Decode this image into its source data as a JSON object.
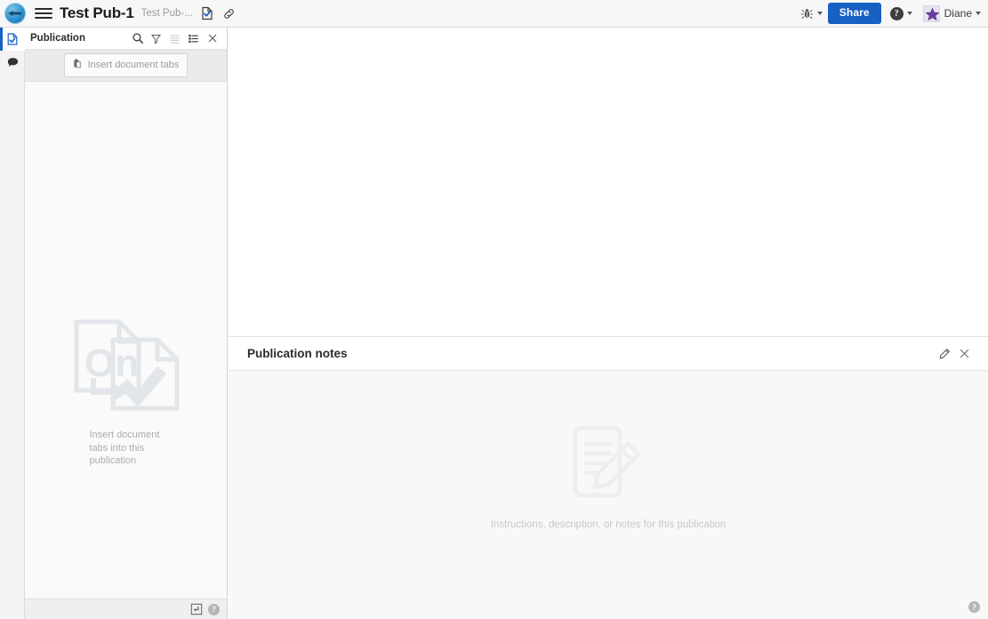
{
  "topbar": {
    "logo_icon": "app-logo-icon",
    "menu_icon": "hamburger-menu-icon",
    "title": "Test Pub-1",
    "subtitle": "Test Pub-...",
    "doc_check_icon": "document-check-icon",
    "link_icon": "link-icon",
    "bug_icon": "bug-icon",
    "share_label": "Share",
    "help_icon": "help-circle-icon",
    "avatar_icon": "user-avatar",
    "user_name": "Diane",
    "accent_color": "#1760c4"
  },
  "rail": {
    "items": [
      {
        "name": "publication-icon",
        "active": true
      },
      {
        "name": "comments-icon",
        "active": false
      }
    ]
  },
  "panel": {
    "title": "Publication",
    "tools": [
      {
        "name": "search-icon",
        "enabled": true
      },
      {
        "name": "filter-icon",
        "enabled": true
      },
      {
        "name": "list-view-icon",
        "enabled": false
      },
      {
        "name": "detail-view-icon",
        "enabled": true
      },
      {
        "name": "close-icon",
        "enabled": true
      }
    ],
    "insert_button_label": "Insert document tabs",
    "insert_button_icon": "insert-document-icon",
    "empty_state_text": "Insert document tabs into this publication",
    "empty_state_icon": "documents-check-illustration",
    "footer": {
      "layout_icon": "panel-layout-icon",
      "help_icon": "help-icon"
    }
  },
  "notes": {
    "title": "Publication notes",
    "edit_icon": "pencil-edit-icon",
    "close_icon": "close-icon",
    "empty_state_text": "Instructions, description, or notes for this publication",
    "empty_state_icon": "notepad-pencil-illustration",
    "corner_help_icon": "help-icon"
  }
}
